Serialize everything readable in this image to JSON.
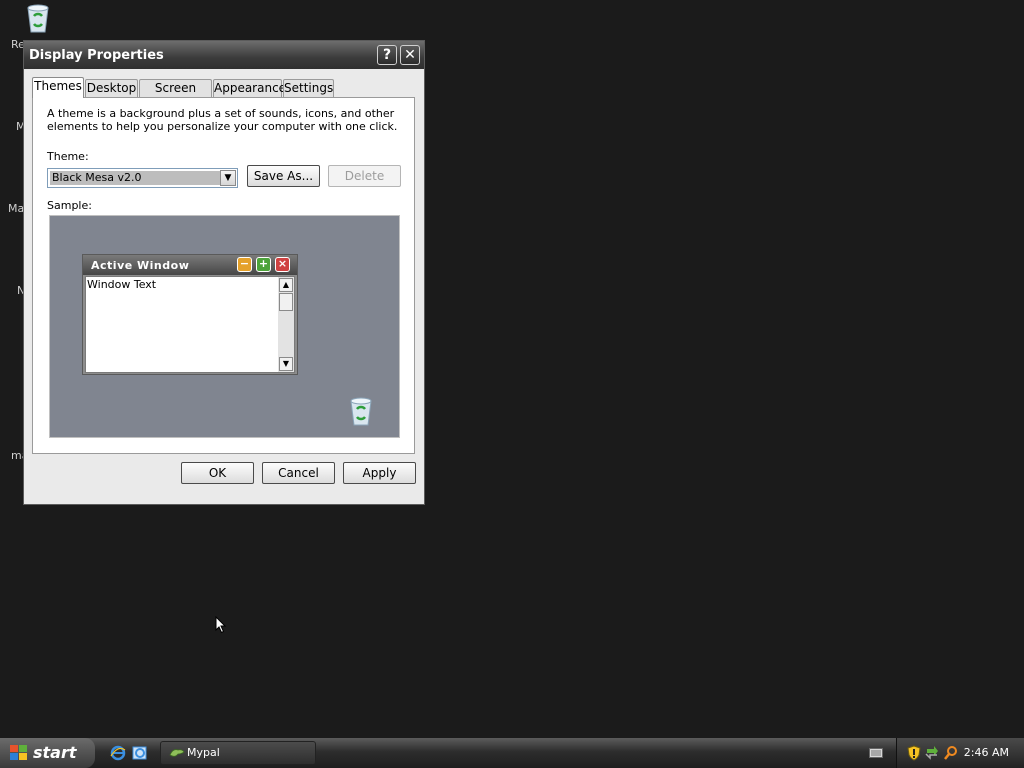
{
  "desktop": {
    "icon_labels": [
      "Re",
      "M",
      "Ma",
      "N",
      "ma"
    ]
  },
  "dialog": {
    "title": "Display Properties",
    "help_label": "?",
    "close_label": "✕",
    "tabs": [
      {
        "label": "Themes",
        "active": true
      },
      {
        "label": "Desktop",
        "active": false
      },
      {
        "label": "Screen Saver",
        "active": false
      },
      {
        "label": "Appearance",
        "active": false
      },
      {
        "label": "Settings",
        "active": false
      }
    ],
    "description": "A theme is a background plus a set of sounds, icons, and other elements to help you personalize your computer with one click.",
    "theme_label": "Theme:",
    "theme_value": "Black Mesa v2.0",
    "save_as_label": "Save As...",
    "delete_label": "Delete",
    "sample_label": "Sample:",
    "sample": {
      "window_title": "Active Window",
      "window_text": "Window Text"
    },
    "ok_label": "OK",
    "cancel_label": "Cancel",
    "apply_label": "Apply"
  },
  "taskbar": {
    "start_label": "start",
    "task_label": "Mypal",
    "clock": "2:46 AM"
  },
  "colors": {
    "desktop_bg": "#1b1b1b",
    "sample_bg": "#808590",
    "mini_close": "#d04242",
    "mini_max": "#4da33b",
    "mini_min": "#e5a12a"
  }
}
